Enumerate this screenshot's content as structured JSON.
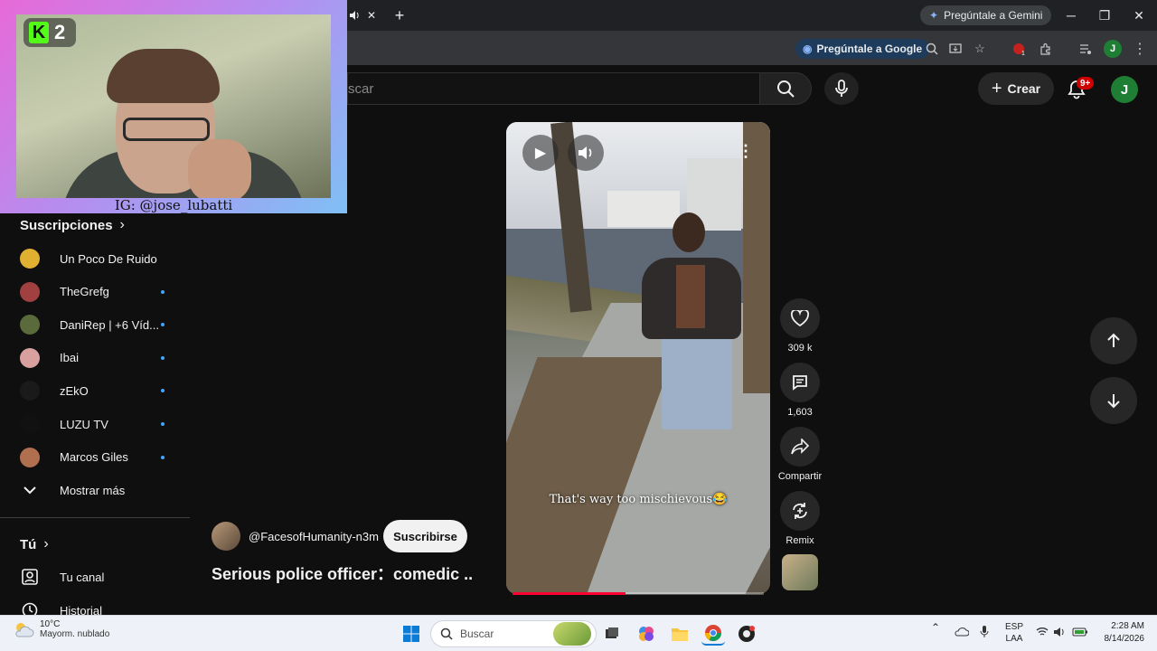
{
  "browser": {
    "gemini_chip": "Pregúntale a Gemini",
    "google_chip": "Pregúntale a Google",
    "ext_badge": "1",
    "profile_initial": "J",
    "tab_close": "✕",
    "new_tab": "+"
  },
  "youtube": {
    "search_placeholder": "scar",
    "crear_label": "Crear",
    "notif_count": "9+",
    "avatar_initial": "J"
  },
  "webcam": {
    "kick_number": "2",
    "ig_handle": "IG: @jose_lubatti"
  },
  "sidebar": {
    "subscriptions_title": "Suscripciones",
    "channels": [
      {
        "name": "Un Poco De Ruido",
        "color": "#e0b030",
        "new": false
      },
      {
        "name": "TheGrefg",
        "color": "#a04040",
        "new": true
      },
      {
        "name": "DaniRep | +6 Víd...",
        "color": "#5a6a3a",
        "new": true
      },
      {
        "name": "Ibai",
        "color": "#d9a0a0",
        "new": true
      },
      {
        "name": "zEkO",
        "color": "#1a1a1a",
        "new": true
      },
      {
        "name": "LUZU TV",
        "color": "#111111",
        "new": true
      },
      {
        "name": "Marcos Giles",
        "color": "#b07050",
        "new": true
      }
    ],
    "show_more": "Mostrar más",
    "you_title": "Tú",
    "your_channel": "Tu canal",
    "history": "Historial"
  },
  "short": {
    "caption": "That's way too mischievous😂",
    "progress": 0.45,
    "likes": "309 k",
    "comments": "1,603",
    "share_label": "Compartir",
    "remix_label": "Remix",
    "channel": "@FacesofHumanity-n3m",
    "subscribe_label": "Suscribirse",
    "title": "Serious police officer：comedic ..."
  },
  "taskbar": {
    "temp": "10°C",
    "weather": "Mayorm. nublado",
    "search_label": "Buscar",
    "lang_top": "ESP",
    "lang_bottom": "LAA",
    "time": "2:28 AM",
    "date": "8/14/2026"
  }
}
